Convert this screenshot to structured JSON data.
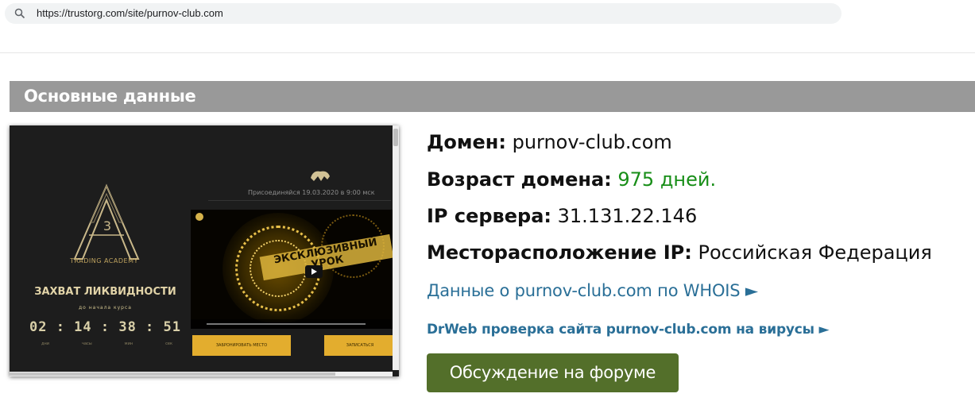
{
  "browser": {
    "url": "https://trustorg.com/site/purnov-club.com",
    "search_icon": "search-icon"
  },
  "section": {
    "title": "Основные данные"
  },
  "screenshot": {
    "brand": "TRADING ACADEMY",
    "logo_letter": "A",
    "logo_number": "3",
    "promo_title": "ЗАХВАТ ЛИКВИДНОСТИ",
    "promo_sub": "до начала курса",
    "countdown": "02 : 14 : 38 : 51",
    "count_labels": [
      "дни",
      "часы",
      "мин",
      "сек"
    ],
    "date_text": "Присоединяйся 19.03.2020 в 9:00 мск",
    "video_title": "ЭКСКЛЮЗИВНЫЙ УРОК",
    "button1": "ЗАБРОНИРОВАТЬ МЕСТО",
    "button2": "ЗАПИСАТЬСЯ"
  },
  "info": {
    "domain_label": "Домен:",
    "domain_value": "purnov-club.com",
    "age_label": "Возраст домена:",
    "age_value": "975 дней.",
    "ip_label": "IP сервера:",
    "ip_value": "31.131.22.146",
    "location_label": "Месторасположение IP:",
    "location_value": "Российская Федерация",
    "whois_link": "Данные о purnov-club.com по WHOIS ►",
    "drweb_link": "DrWeb проверка сайта purnov-club.com на вирусы ►",
    "forum_button": "Обсуждение на форуме"
  },
  "colors": {
    "header_bg": "#999999",
    "age_green": "#188e18",
    "link_blue": "#2a6f97",
    "forum_green": "#536f2a"
  }
}
